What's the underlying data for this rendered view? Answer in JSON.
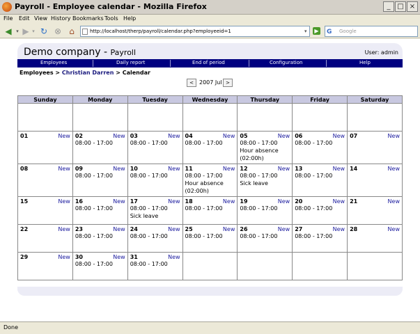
{
  "window": {
    "title": "Payroll - Employee calendar - Mozilla Firefox"
  },
  "menu": [
    "File",
    "Edit",
    "View",
    "History",
    "Bookmarks",
    "Tools",
    "Help"
  ],
  "browser": {
    "url": "http://localhost/therp/payroll/calendar.php?employeeid=1",
    "search_placeholder": "Google",
    "status": "Done"
  },
  "app": {
    "company": "Demo company",
    "module": "Payroll",
    "user_label": "User: admin"
  },
  "nav": [
    "Employees",
    "Daily report",
    "End of period",
    "Configuration",
    "Help"
  ],
  "breadcrumb": {
    "root": "Employees",
    "sep1": ">",
    "employee": "Christian Darren",
    "sep2": ">",
    "current": "Calendar"
  },
  "month_nav": {
    "prev": "<",
    "label": "2007 Jul",
    "next": ">"
  },
  "calendar": {
    "weekdays": [
      "Sunday",
      "Monday",
      "Tuesday",
      "Wednesday",
      "Thursday",
      "Friday",
      "Saturday"
    ],
    "new_label": "New",
    "weeks": [
      [
        {
          "day": "",
          "lines": []
        },
        {
          "day": "",
          "lines": []
        },
        {
          "day": "",
          "lines": []
        },
        {
          "day": "",
          "lines": []
        },
        {
          "day": "",
          "lines": []
        },
        {
          "day": "",
          "lines": []
        },
        {
          "day": "",
          "lines": []
        }
      ],
      [
        {
          "day": "01",
          "lines": []
        },
        {
          "day": "02",
          "lines": [
            "08:00 - 17:00"
          ]
        },
        {
          "day": "03",
          "lines": [
            "08:00 - 17:00"
          ]
        },
        {
          "day": "04",
          "lines": [
            "08:00 - 17:00"
          ]
        },
        {
          "day": "05",
          "lines": [
            "08:00 - 17:00",
            "Hour absence",
            "(02:00h)"
          ]
        },
        {
          "day": "06",
          "lines": [
            "08:00 - 17:00"
          ]
        },
        {
          "day": "07",
          "lines": []
        }
      ],
      [
        {
          "day": "08",
          "lines": []
        },
        {
          "day": "09",
          "lines": [
            "08:00 - 17:00"
          ]
        },
        {
          "day": "10",
          "lines": [
            "08:00 - 17:00"
          ]
        },
        {
          "day": "11",
          "lines": [
            "08:00 - 17:00",
            "Hour absence",
            "(02:00h)"
          ]
        },
        {
          "day": "12",
          "lines": [
            "08:00 - 17:00",
            "Sick leave"
          ]
        },
        {
          "day": "13",
          "lines": [
            "08:00 - 17:00"
          ]
        },
        {
          "day": "14",
          "lines": []
        }
      ],
      [
        {
          "day": "15",
          "lines": []
        },
        {
          "day": "16",
          "lines": [
            "08:00 - 17:00"
          ]
        },
        {
          "day": "17",
          "lines": [
            "08:00 - 17:00",
            "Sick leave"
          ]
        },
        {
          "day": "18",
          "lines": [
            "08:00 - 17:00"
          ]
        },
        {
          "day": "19",
          "lines": [
            "08:00 - 17:00"
          ]
        },
        {
          "day": "20",
          "lines": [
            "08:00 - 17:00"
          ]
        },
        {
          "day": "21",
          "lines": []
        }
      ],
      [
        {
          "day": "22",
          "lines": []
        },
        {
          "day": "23",
          "lines": [
            "08:00 - 17:00"
          ]
        },
        {
          "day": "24",
          "lines": [
            "08:00 - 17:00"
          ]
        },
        {
          "day": "25",
          "lines": [
            "08:00 - 17:00"
          ]
        },
        {
          "day": "26",
          "lines": [
            "08:00 - 17:00"
          ]
        },
        {
          "day": "27",
          "lines": [
            "08:00 - 17:00"
          ]
        },
        {
          "day": "28",
          "lines": []
        }
      ],
      [
        {
          "day": "29",
          "lines": []
        },
        {
          "day": "30",
          "lines": [
            "08:00 - 17:00"
          ]
        },
        {
          "day": "31",
          "lines": [
            "08:00 - 17:00"
          ]
        },
        {
          "day": "",
          "lines": []
        },
        {
          "day": "",
          "lines": []
        },
        {
          "day": "",
          "lines": []
        },
        {
          "day": "",
          "lines": []
        }
      ]
    ]
  }
}
